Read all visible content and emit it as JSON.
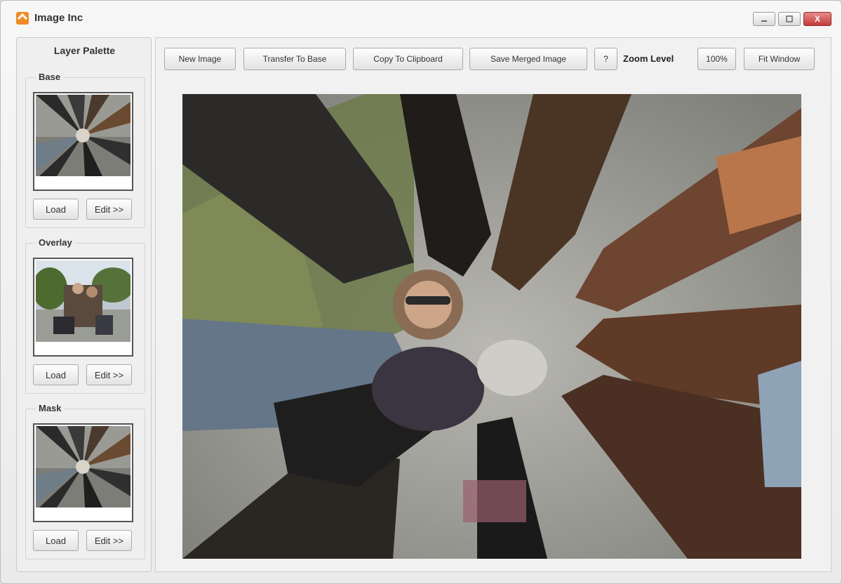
{
  "window": {
    "title": "Image Inc",
    "minimize_label": "",
    "maximize_label": "",
    "close_label": "X"
  },
  "palette": {
    "title": "Layer Palette",
    "base": {
      "label": "Base",
      "load_label": "Load",
      "edit_label": "Edit >>"
    },
    "overlay": {
      "label": "Overlay",
      "load_label": "Load",
      "edit_label": "Edit >>"
    },
    "mask": {
      "label": "Mask",
      "load_label": "Load",
      "edit_label": "Edit >>"
    }
  },
  "toolbar": {
    "new_image": "New Image",
    "transfer_to_base": "Transfer To Base",
    "copy_to_clipboard": "Copy To Clipboard",
    "save_merged_image": "Save Merged Image",
    "help": "?",
    "zoom_level_label": "Zoom Level",
    "zoom_value": "100%",
    "fit_window": "Fit Window"
  },
  "colors": {
    "accent": "#f08a24",
    "close_button": "#c23b3b"
  },
  "icons": {
    "app": "app-icon",
    "minimize": "minimize-icon",
    "maximize": "maximize-icon",
    "close": "close-icon"
  }
}
